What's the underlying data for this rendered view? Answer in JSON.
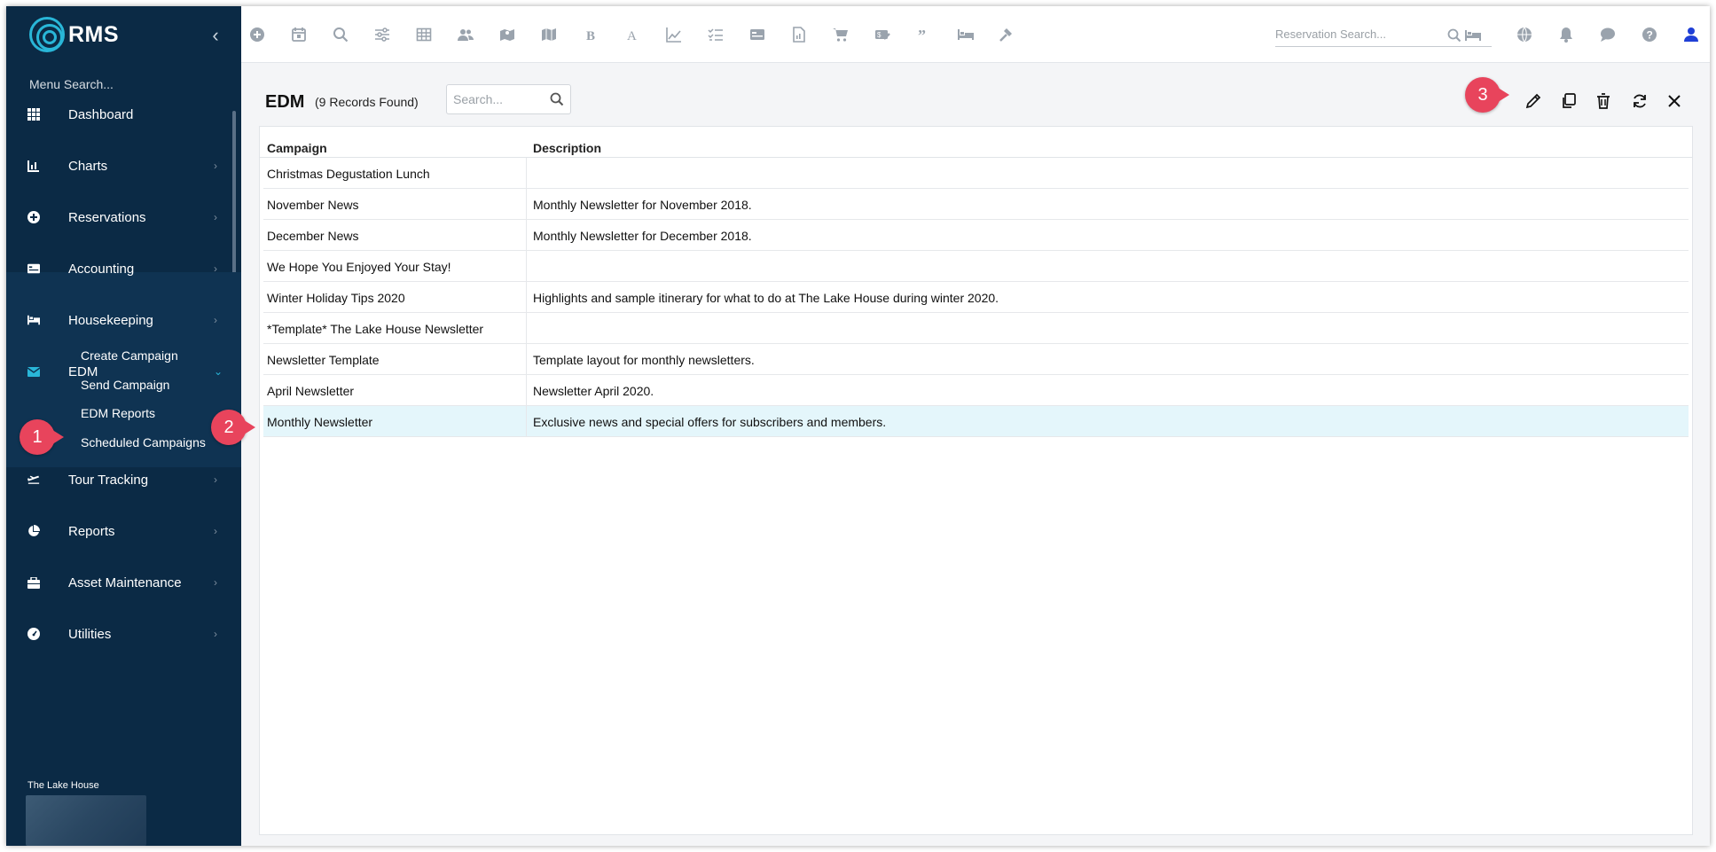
{
  "sidebar": {
    "logo_text": "RMS",
    "menu_search": "Menu Search...",
    "items": [
      {
        "label": "Dashboard",
        "icon": "dashboard-grid-icon"
      },
      {
        "label": "Charts",
        "icon": "chart-icon"
      },
      {
        "label": "Reservations",
        "icon": "plus-circle-icon"
      },
      {
        "label": "Accounting",
        "icon": "card-icon"
      },
      {
        "label": "Housekeeping",
        "icon": "bed-icon"
      },
      {
        "label": "EDM",
        "icon": "envelope-icon"
      },
      {
        "label": "Tour Tracking",
        "icon": "plane-icon"
      },
      {
        "label": "Reports",
        "icon": "pie-icon"
      },
      {
        "label": "Asset Maintenance",
        "icon": "toolbox-icon"
      },
      {
        "label": "Utilities",
        "icon": "gauge-icon"
      }
    ],
    "edm_sub": [
      "Create Campaign",
      "Send Campaign",
      "EDM Reports",
      "Scheduled Campaigns"
    ],
    "property_name": "The Lake House"
  },
  "topbar": {
    "reservation_search_placeholder": "Reservation Search..."
  },
  "page": {
    "title": "EDM",
    "record_count": "(9 Records Found)",
    "search_placeholder": "Search..."
  },
  "grid": {
    "columns": [
      "Campaign",
      "Description"
    ],
    "rows": [
      {
        "campaign": "Christmas Degustation Lunch",
        "description": ""
      },
      {
        "campaign": "November News",
        "description": "Monthly Newsletter for November 2018."
      },
      {
        "campaign": "December News",
        "description": "Monthly Newsletter for December 2018."
      },
      {
        "campaign": "We Hope You Enjoyed Your Stay!",
        "description": ""
      },
      {
        "campaign": "Winter Holiday Tips 2020",
        "description": "Highlights and sample itinerary for what to do at The Lake House during winter 2020."
      },
      {
        "campaign": "*Template* The Lake House Newsletter",
        "description": ""
      },
      {
        "campaign": "Newsletter Template",
        "description": "Template layout for monthly newsletters."
      },
      {
        "campaign": "April Newsletter",
        "description": "Newsletter April 2020."
      },
      {
        "campaign": "Monthly Newsletter",
        "description": "Exclusive news and special offers for subscribers and members."
      }
    ],
    "selected_index": 8
  },
  "callouts": [
    "1",
    "2",
    "3"
  ],
  "colors": {
    "sidebar_bg": "#0b2a45",
    "accent": "#29b6d8",
    "callout": "#e8445c",
    "selected_row": "#e4f6fb"
  }
}
